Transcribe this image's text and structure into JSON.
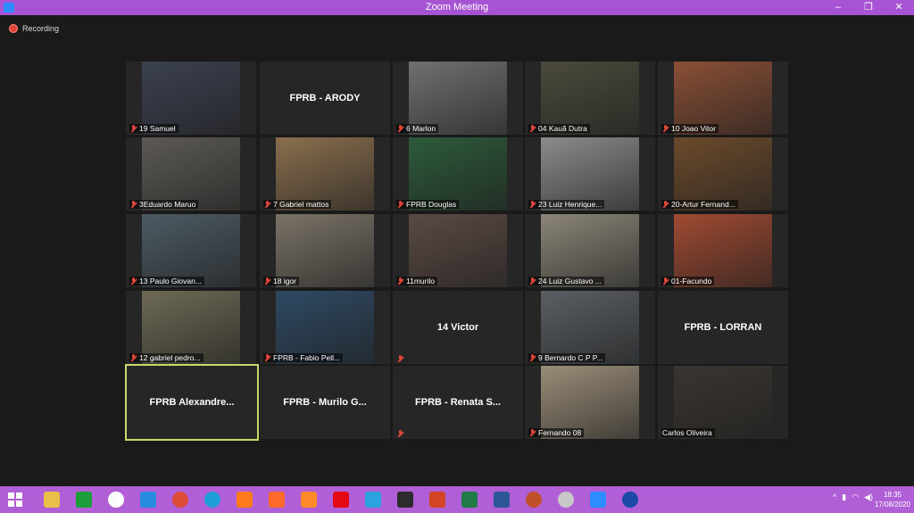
{
  "window": {
    "title": "Zoom Meeting",
    "controls": [
      "–",
      "❐",
      "✕"
    ]
  },
  "recording": {
    "label": "Recording"
  },
  "participants": [
    {
      "name": "19 Samuel",
      "video": true,
      "muted": true,
      "color": "#3c4150"
    },
    {
      "name": "FPRB - ARODY",
      "video": false,
      "muted": false
    },
    {
      "name": "6 Marlon",
      "video": true,
      "muted": true,
      "color": "#707070"
    },
    {
      "name": "04 Kauã Dutra",
      "video": true,
      "muted": true,
      "color": "#4b4a3c"
    },
    {
      "name": "10 Joao Vitor",
      "video": true,
      "muted": true,
      "color": "#8a4f36"
    },
    {
      "name": "3Eduardo Maruo",
      "video": true,
      "muted": true,
      "color": "#5d5a55"
    },
    {
      "name": "7 Gabriel mattos",
      "video": true,
      "muted": true,
      "color": "#8a6f4e"
    },
    {
      "name": "FPRB Douglas",
      "video": true,
      "muted": true,
      "color": "#2d5a3b"
    },
    {
      "name": "23 Luiz Henrique...",
      "video": true,
      "muted": true,
      "color": "#8b8b8b"
    },
    {
      "name": "20-Artur Fernand...",
      "video": true,
      "muted": true,
      "color": "#6b4a2c"
    },
    {
      "name": "13 Paulo Giovan...",
      "video": true,
      "muted": true,
      "color": "#4d5a63"
    },
    {
      "name": "18 igor",
      "video": true,
      "muted": true,
      "color": "#7a7368"
    },
    {
      "name": "11murilo",
      "video": true,
      "muted": true,
      "color": "#5a4a44"
    },
    {
      "name": "24 Luiz Gustavo ...",
      "video": true,
      "muted": true,
      "color": "#8b8578"
    },
    {
      "name": "01-Facundo",
      "video": true,
      "muted": true,
      "color": "#a04a32"
    },
    {
      "name": "12 gabriel pedro...",
      "video": true,
      "muted": true,
      "color": "#6e6a55"
    },
    {
      "name": "FPRB - Fabio Pell...",
      "video": true,
      "muted": true,
      "color": "#2f4a63"
    },
    {
      "name": "14 Victor",
      "video": false,
      "muted": true
    },
    {
      "name": "9 Bernardo C P P...",
      "video": true,
      "muted": true,
      "color": "#5a5f63"
    },
    {
      "name": "FPRB - LORRAN",
      "video": false,
      "muted": false
    },
    {
      "name": "FPRB  Alexandre...",
      "video": false,
      "muted": false,
      "active": true
    },
    {
      "name": "FPRB - Murilo G...",
      "video": false,
      "muted": false
    },
    {
      "name": "FPRB - Renata S...",
      "video": false,
      "muted": true
    },
    {
      "name": "Fernando 08",
      "video": true,
      "muted": true,
      "color": "#9a8d78"
    },
    {
      "name": "Carlos Oliveira",
      "video": true,
      "muted": false,
      "color": "#3a3530"
    }
  ],
  "taskbar": {
    "icons": [
      {
        "name": "file-explorer-icon",
        "color": "#e8c04a"
      },
      {
        "name": "store-icon",
        "color": "#1e9e3a"
      },
      {
        "name": "hp-icon",
        "color": "#ffffff"
      },
      {
        "name": "internet-explorer-icon",
        "color": "#2a8ce0"
      },
      {
        "name": "chrome-icon",
        "color": "#dd4b39"
      },
      {
        "name": "edge-icon",
        "color": "#1e9dd8"
      },
      {
        "name": "avast-icon",
        "color": "#ff7a1a"
      },
      {
        "name": "rocket-app-icon",
        "color": "#ff6a2a"
      },
      {
        "name": "orange-app-icon",
        "color": "#ff8a2a"
      },
      {
        "name": "netflix-icon",
        "color": "#e50914"
      },
      {
        "name": "telegram-icon",
        "color": "#2aa3de"
      },
      {
        "name": "audio-app-icon",
        "color": "#2c2c2c"
      },
      {
        "name": "powerpoint-icon",
        "color": "#d24625"
      },
      {
        "name": "excel-icon",
        "color": "#1f7a45"
      },
      {
        "name": "word-icon",
        "color": "#2b5797"
      },
      {
        "name": "ball-app-icon",
        "color": "#c0502a"
      },
      {
        "name": "globe-app-icon",
        "color": "#c8c8c8"
      },
      {
        "name": "zoom-icon",
        "color": "#2d8cff"
      },
      {
        "name": "help-icon",
        "color": "#1a4aa8"
      }
    ],
    "clock": {
      "time": "18:35",
      "date": "17/08/2020"
    }
  }
}
